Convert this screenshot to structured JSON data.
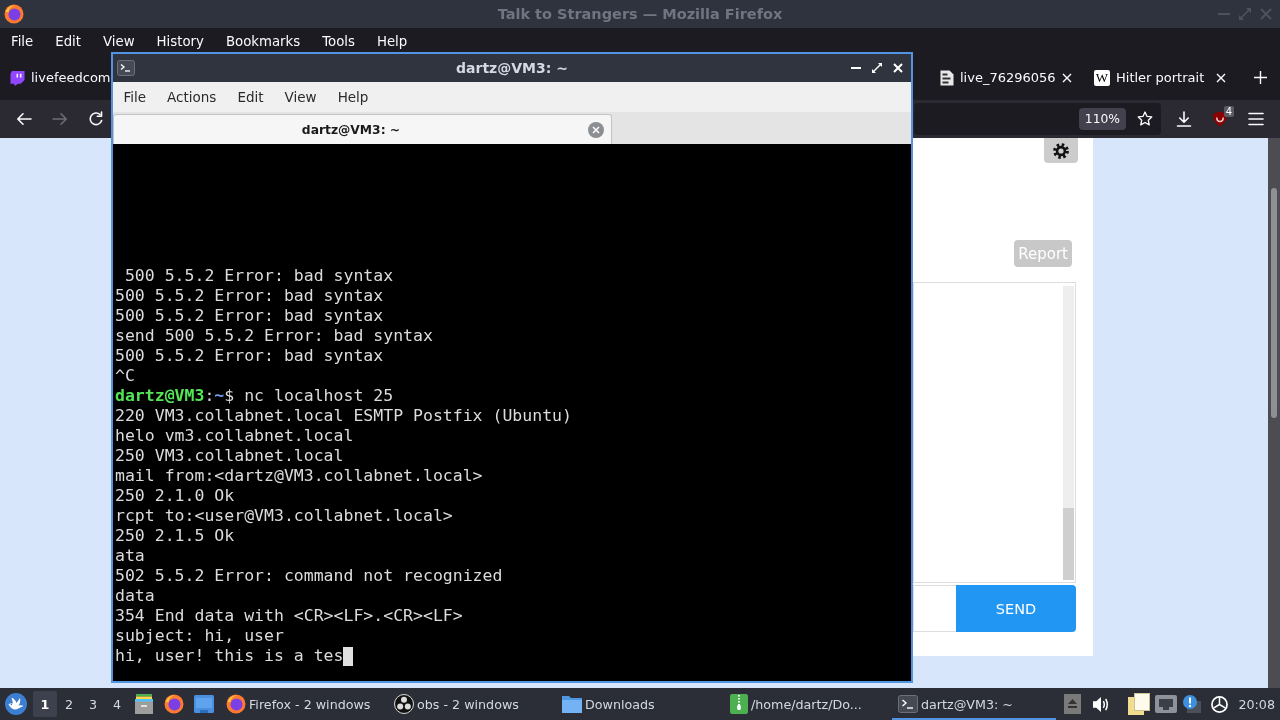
{
  "firefox": {
    "title": "Talk to Strangers — Mozilla Firefox",
    "active": false,
    "menu": [
      "File",
      "Edit",
      "View",
      "History",
      "Bookmarks",
      "Tools",
      "Help"
    ],
    "tabs": [
      {
        "label": "livefeedcom",
        "kind": "stream",
        "selected": false,
        "close_button": false
      },
      {
        "label": "live_76296056",
        "kind": "document",
        "selected": false,
        "close_button": true
      },
      {
        "label": "Hitler portrait",
        "kind": "letter",
        "icon_text": "W",
        "selected": false,
        "close_button": true
      }
    ],
    "nav_buttons": [
      {
        "kind": "back",
        "disabled": false
      },
      {
        "kind": "forward",
        "disabled": true
      },
      {
        "kind": "reload",
        "disabled": false
      }
    ],
    "zoom": "110%",
    "extension_badge": "4"
  },
  "page": {
    "report_button": "Report",
    "send_button": "SEND"
  },
  "terminal": {
    "title": "dartz@VM3: ~",
    "active": true,
    "menu": [
      "File",
      "Actions",
      "Edit",
      "View",
      "Help"
    ],
    "tabs": [
      {
        "label": "dartz@VM3: ~",
        "selected": true
      }
    ],
    "lines": [
      {
        "kind": "output",
        "text": " 500 5.5.2 Error: bad syntax"
      },
      {
        "kind": "output",
        "text": "500 5.5.2 Error: bad syntax"
      },
      {
        "kind": "output",
        "text": "500 5.5.2 Error: bad syntax"
      },
      {
        "kind": "output",
        "text": "send 500 5.5.2 Error: bad syntax"
      },
      {
        "kind": "output",
        "text": "500 5.5.2 Error: bad syntax"
      },
      {
        "kind": "output",
        "text": "^C"
      },
      {
        "kind": "prompt",
        "user": "dartz@VM3",
        "separator": ":",
        "path": "~",
        "command": "$ nc localhost 25"
      },
      {
        "kind": "output",
        "text": "220 VM3.collabnet.local ESMTP Postfix (Ubuntu)"
      },
      {
        "kind": "output",
        "text": "helo vm3.collabnet.local"
      },
      {
        "kind": "output",
        "text": "250 VM3.collabnet.local"
      },
      {
        "kind": "output",
        "text": "mail from:<dartz@VM3.collabnet.local>"
      },
      {
        "kind": "output",
        "text": "250 2.1.0 Ok"
      },
      {
        "kind": "output",
        "text": "rcpt to:<user@VM3.collabnet.local>"
      },
      {
        "kind": "output",
        "text": "250 2.1.5 Ok"
      },
      {
        "kind": "output",
        "text": "ata"
      },
      {
        "kind": "output",
        "text": "502 5.5.2 Error: command not recognized"
      },
      {
        "kind": "output",
        "text": "data"
      },
      {
        "kind": "output",
        "text": "354 End data with <CR><LF>.<CR><LF>"
      },
      {
        "kind": "output",
        "text": "subject: hi, user"
      },
      {
        "kind": "output",
        "text": "hi, user! this is a tes"
      }
    ],
    "cursor": true
  },
  "taskbar": {
    "workspaces": [
      {
        "label": "1",
        "selected": true
      },
      {
        "label": "2",
        "selected": false
      },
      {
        "label": "3",
        "selected": false
      },
      {
        "label": "4",
        "selected": false
      }
    ],
    "tasks": [
      {
        "label": "Firefox - 2 windows",
        "kind": "browser",
        "selected": false
      },
      {
        "label": "obs - 2 windows",
        "kind": "recorder",
        "selected": false
      },
      {
        "label": "Downloads",
        "kind": "folder",
        "selected": false
      },
      {
        "label": "/home/dartz/Do...",
        "kind": "archive",
        "selected": false
      },
      {
        "label": "dartz@VM3: ~",
        "kind": "terminal",
        "selected": true
      }
    ],
    "clock": "20:08"
  }
}
